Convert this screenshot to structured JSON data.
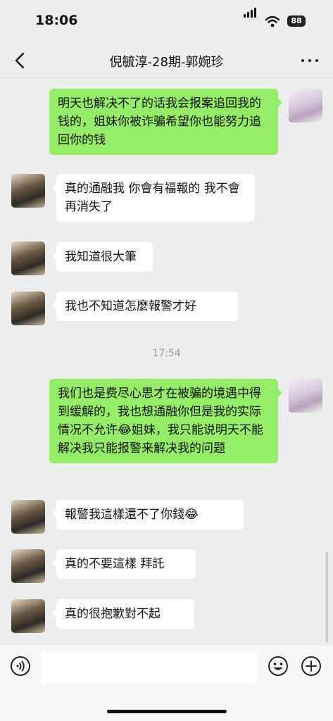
{
  "status_bar": {
    "time": "18:06",
    "battery": "88"
  },
  "header": {
    "title": "倪毓淳-28期-郭婉珍"
  },
  "messages": [
    {
      "side": "out",
      "text": "明天也解决不了的话我会报案追回我的钱的，姐妹你被诈骗希望你也能努力追回你的钱"
    },
    {
      "side": "in",
      "text": "真的通融我 你會有福報的 我不會再消失了"
    },
    {
      "side": "in",
      "text": "我知道很大筆"
    },
    {
      "side": "in",
      "text": "我也不知道怎麼報警才好"
    },
    {
      "side": "out",
      "text": "我们也是费尽心思才在被骗的境遇中得到缓解的，我也想通融你但是我的实际情况不允许😂姐妹，我只能说明天不能解决我只能报警来解决我的问题"
    },
    {
      "side": "in",
      "text": "報警我這樣還不了你錢😂"
    },
    {
      "side": "in",
      "text": "真的不要這樣 拜託"
    },
    {
      "side": "in",
      "text": "真的很抱歉對不起"
    }
  ],
  "timestamp": "17:54",
  "input_bar": {
    "placeholder": ""
  },
  "icons": {
    "back": "chevron-left-icon",
    "more": "more-dots-icon",
    "voice": "voice-icon",
    "emoji": "emoji-icon",
    "plus": "plus-icon"
  }
}
